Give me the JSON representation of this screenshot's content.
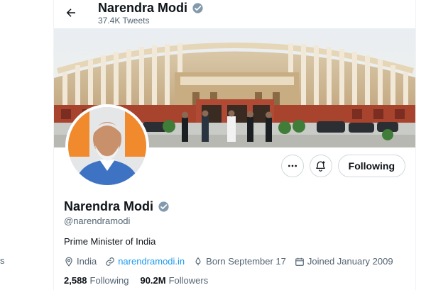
{
  "header": {
    "name": "Narendra Modi",
    "tweet_count": "37.4K Tweets"
  },
  "profile": {
    "name": "Narendra Modi",
    "handle": "@narendramodi",
    "bio": "Prime Minister of India",
    "location": "India",
    "website": "narendramodi.in",
    "born": "Born September 17",
    "joined": "Joined January 2009",
    "following_count": "2,588",
    "following_label": "Following",
    "followers_count": "90.2M",
    "followers_label": "Followers"
  },
  "actions": {
    "follow_label": "Following"
  },
  "colors": {
    "verified": "#829aab",
    "link": "#1d9bf0",
    "muted": "#536471"
  },
  "icons": [
    "back-arrow-icon",
    "verified-badge-icon",
    "more-icon",
    "notification-bell-icon",
    "location-pin-icon",
    "link-icon",
    "birthday-icon",
    "calendar-icon"
  ]
}
